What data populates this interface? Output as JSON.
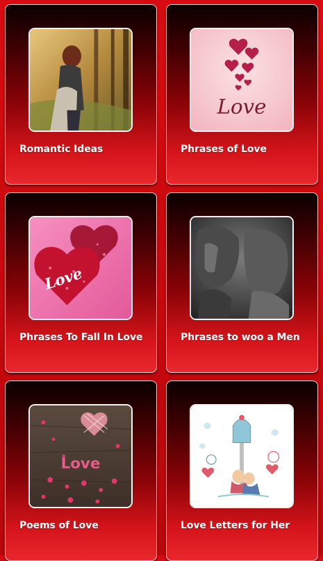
{
  "menu": {
    "items": [
      {
        "label": "Romantic Ideas",
        "image": "romantic-couple-image"
      },
      {
        "label": "Phrases of Love",
        "image": "love-hearts-image"
      },
      {
        "label": "Phrases To Fall In Love",
        "image": "glitter-hearts-image"
      },
      {
        "label": "Phrases to woo a Men",
        "image": "kissing-couple-image"
      },
      {
        "label": "Poems of Love",
        "image": "love-petals-image"
      },
      {
        "label": "Love Letters for Her",
        "image": "cartoon-couple-image"
      }
    ]
  },
  "images": {
    "love_text": "Love",
    "love_sweet_text": "Love"
  },
  "colors": {
    "background": "#d80c10",
    "card_gradient_top": "#0b0000",
    "card_gradient_bottom": "#e8282c",
    "label": "#ffffff"
  }
}
